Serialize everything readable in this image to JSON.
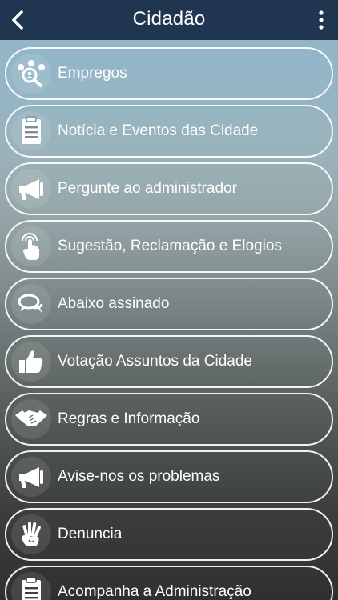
{
  "header": {
    "title": "Cidadão",
    "back_icon": "chevron-left-icon",
    "more_icon": "vertical-ellipsis-icon",
    "background": "#1f3550"
  },
  "menu": {
    "items": [
      {
        "label": "Empregos",
        "icon": "people-search-icon"
      },
      {
        "label": "Notícia e Eventos das Cidade",
        "icon": "clipboard-icon"
      },
      {
        "label": "Pergunte ao administrador",
        "icon": "megaphone-icon"
      },
      {
        "label": "Sugestão, Reclamação e Elogios",
        "icon": "touch-hand-icon"
      },
      {
        "label": "Abaixo assinado",
        "icon": "chat-bubbles-icon"
      },
      {
        "label": "Votação Assuntos da Cidade",
        "icon": "thumbs-up-icon"
      },
      {
        "label": "Regras e Informação",
        "icon": "handshake-icon"
      },
      {
        "label": "Avise-nos os problemas",
        "icon": "megaphone-icon"
      },
      {
        "label": "Denuncia",
        "icon": "hand-icon"
      },
      {
        "label": "Acompanha a Administração",
        "icon": "clipboard-icon"
      }
    ]
  }
}
